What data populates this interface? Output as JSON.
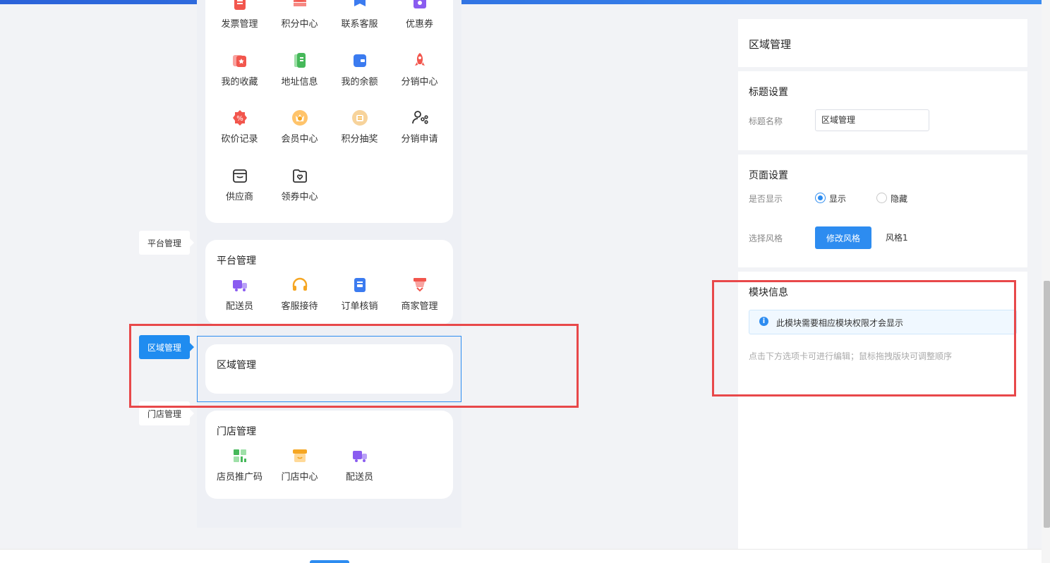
{
  "menu_card_1": {
    "items": [
      {
        "label": "发票管理",
        "icon": "invoice-icon",
        "color": "#f2564d"
      },
      {
        "label": "积分中心",
        "icon": "points-stack-icon",
        "color": "#f2564d"
      },
      {
        "label": "联系客服",
        "icon": "service-flag-icon",
        "color": "#3b7bf0"
      },
      {
        "label": "优惠券",
        "icon": "coupon-icon",
        "color": "#8a5cf0"
      },
      {
        "label": "我的收藏",
        "icon": "favorite-icon",
        "color": "#f2564d"
      },
      {
        "label": "地址信息",
        "icon": "address-book-icon",
        "color": "#46b85a"
      },
      {
        "label": "我的余额",
        "icon": "wallet-icon",
        "color": "#3b7bf0"
      },
      {
        "label": "分销中心",
        "icon": "rocket-icon",
        "color": "#f2564d"
      },
      {
        "label": "砍价记录",
        "icon": "discount-badge-icon",
        "color": "#f2564d"
      },
      {
        "label": "会员中心",
        "icon": "vip-crown-icon",
        "color": "#f5a623"
      },
      {
        "label": "积分抽奖",
        "icon": "lottery-icon",
        "color": "#f5a623"
      },
      {
        "label": "分销申请",
        "icon": "user-share-icon",
        "color": "#333333"
      },
      {
        "label": "供应商",
        "icon": "store-box-icon",
        "color": "#333333"
      },
      {
        "label": "领券中心",
        "icon": "coupon-folder-icon",
        "color": "#333333"
      }
    ]
  },
  "section_tags": {
    "platform": "平台管理",
    "region": "区域管理",
    "store": "门店管理"
  },
  "platform_card": {
    "title": "平台管理",
    "items": [
      {
        "label": "配送员",
        "icon": "delivery-truck-icon",
        "color": "#8a5cf0"
      },
      {
        "label": "客服接待",
        "icon": "headset-icon",
        "color": "#f5a623"
      },
      {
        "label": "订单核销",
        "icon": "order-verify-icon",
        "color": "#3b7bf0"
      },
      {
        "label": "商家管理",
        "icon": "merchant-icon",
        "color": "#f2564d"
      }
    ]
  },
  "region_card": {
    "title": "区域管理"
  },
  "store_card": {
    "title": "门店管理",
    "items": [
      {
        "label": "店员推广码",
        "icon": "qrcode-icon",
        "color": "#46b85a"
      },
      {
        "label": "门店中心",
        "icon": "shop-icon",
        "color": "#f5a623"
      },
      {
        "label": "配送员",
        "icon": "delivery-truck-icon",
        "color": "#8a5cf0"
      }
    ]
  },
  "settings": {
    "header_title": "区域管理",
    "title_section": {
      "heading": "标题设置",
      "name_label": "标题名称",
      "name_value": "区域管理"
    },
    "page_section": {
      "heading": "页面设置",
      "show_label": "是否显示",
      "show_option": "显示",
      "hide_option": "隐藏",
      "show_selected": true,
      "style_label": "选择风格",
      "style_button": "修改风格",
      "style_value": "风格1"
    },
    "module_section": {
      "heading": "模块信息",
      "notice": "此模块需要相应模块权限才会显示",
      "hint": "点击下方选项卡可进行编辑；鼠标拖拽版块可调整顺序"
    }
  },
  "colors": {
    "accent": "#2d8cf0",
    "highlight_red": "#e8484a",
    "tag_active": "#1f8cf0"
  }
}
